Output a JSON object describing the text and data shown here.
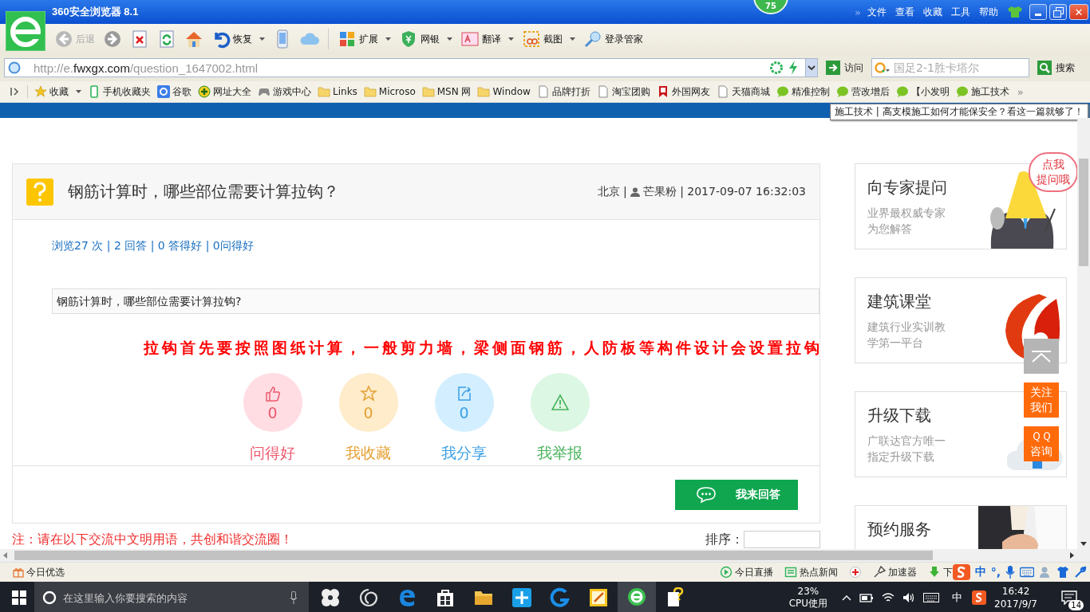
{
  "window": {
    "title": "360安全浏览器 8.1",
    "badge": "75",
    "menu_more": "»",
    "menu": [
      "文件",
      "查看",
      "收藏",
      "工具",
      "帮助"
    ],
    "close": "✕"
  },
  "toolbar": [
    {
      "kind": "back",
      "label": "后退",
      "disabled": true
    },
    {
      "kind": "forward"
    },
    {
      "kind": "stop"
    },
    {
      "kind": "refresh"
    },
    {
      "kind": "home"
    },
    {
      "kind": "undo",
      "label": "恢复",
      "caret": true
    },
    {
      "kind": "phone"
    },
    {
      "kind": "cloud"
    },
    {
      "kind": "extensions",
      "label": "扩展",
      "caret": true
    },
    {
      "kind": "bank",
      "label": "网银",
      "caret": true
    },
    {
      "kind": "translate",
      "label": "翻译",
      "caret": true
    },
    {
      "kind": "screenshot",
      "label": "截图",
      "caret": true
    },
    {
      "kind": "login",
      "label": "登录管家"
    }
  ],
  "address_bar": {
    "prefix": "http://e.",
    "domain": "fwxgx.com",
    "path": "/question_1647002.html",
    "go": "访问"
  },
  "search": {
    "placeholder": "国足2-1胜卡塔尔",
    "button": "搜索"
  },
  "bookmarks": [
    {
      "kind": "star",
      "label": "收藏",
      "caret": true
    },
    {
      "kind": "phone",
      "label": "手机收藏夹"
    },
    {
      "kind": "google",
      "label": "谷歌"
    },
    {
      "kind": "plus",
      "label": "网址大全"
    },
    {
      "kind": "gamepad",
      "label": "游戏中心"
    },
    {
      "kind": "folder",
      "label": "Links"
    },
    {
      "kind": "folder",
      "label": "Microso"
    },
    {
      "kind": "folder",
      "label": "MSN 网"
    },
    {
      "kind": "folder",
      "label": "Window"
    },
    {
      "kind": "page",
      "label": "品牌打折"
    },
    {
      "kind": "page",
      "label": "淘宝团购"
    },
    {
      "kind": "flag",
      "label": "外国网友"
    },
    {
      "kind": "page",
      "label": "天猫商城"
    },
    {
      "kind": "chat",
      "label": "精准控制"
    },
    {
      "kind": "chat",
      "label": "营改增后"
    },
    {
      "kind": "chat",
      "label": "【小发明"
    },
    {
      "kind": "chat",
      "label": "施工技术"
    }
  ],
  "bookmarks_more": "»",
  "tooltip": "施工技术 | 高支模施工如何才能保安全？看这一篇就够了！",
  "question": {
    "title": "钢筋计算时，哪些部位需要计算拉钩？",
    "location": "北京 |",
    "byline": "芒果粉 | 2017-09-07 16:32:03",
    "stats": "浏览27 次 | 2 回答 | 0 答得好 | 0问得好",
    "body": "钢筋计算时，哪些部位需要计算拉钩?",
    "answer": "拉钩首先要按照图纸计算，一般剪力墙，梁侧面钢筋，人防板等构件设计会设置拉钩"
  },
  "actions": [
    {
      "kind": "like",
      "count": "0",
      "label": "问得好",
      "color": "#ee5a6e"
    },
    {
      "kind": "favorite",
      "count": "0",
      "label": "我收藏",
      "color": "#e5a032"
    },
    {
      "kind": "share",
      "count": "0",
      "label": "我分享",
      "color": "#3a9fe6"
    },
    {
      "kind": "report",
      "label": "我举报",
      "color": "#48b25a"
    }
  ],
  "answer_button": "我来回答",
  "notice": "注：请在以下交流中文明用语，共创和谐交流圈！",
  "sort_label": "排序：",
  "sidebar": [
    {
      "kind": "mascot",
      "title": "向专家提问",
      "subtitle": "业界最权威专家为您解答",
      "callout": [
        "点我",
        "提问哦"
      ]
    },
    {
      "kind": "logo",
      "title": "建筑课堂",
      "subtitle": "建筑行业实训教学第一平台"
    },
    {
      "kind": "cloud",
      "title": "升级下载",
      "subtitle": "广联达官方唯一指定升级下载"
    },
    {
      "title": "预约服务"
    }
  ],
  "float_buttons": [
    {
      "kind": "top"
    },
    {
      "kind": "text",
      "label": "关注我们"
    },
    {
      "kind": "text",
      "label": "ＱＱ咨询"
    }
  ],
  "status_bar": {
    "left": "今日优选",
    "items": [
      {
        "kind": "play",
        "label": "今日直播"
      },
      {
        "kind": "news",
        "label": "热点新闻"
      },
      {
        "kind": "cross"
      },
      {
        "kind": "rocket",
        "label": "加速器"
      },
      {
        "kind": "download",
        "label": "下"
      }
    ],
    "ime": [
      "中",
      "°,"
    ]
  },
  "taskbar": {
    "search_placeholder": "在这里输入你要搜索的内容",
    "apps": [
      {
        "kind": "fan",
        "selected": false
      },
      {
        "kind": "swirl",
        "selected": false
      },
      {
        "kind": "edge",
        "selected": false
      },
      {
        "kind": "store",
        "selected": false
      },
      {
        "kind": "folder",
        "selected": false
      },
      {
        "kind": "plus",
        "selected": false
      },
      {
        "kind": "g",
        "selected": false
      },
      {
        "kind": "notes",
        "selected": false
      },
      {
        "kind": "browser",
        "selected": true
      },
      {
        "kind": "help",
        "selected": false
      }
    ],
    "cpu": "23%",
    "cpu_label": "CPU使用",
    "ime": "中",
    "time": "16:42",
    "date": "2017/9/7",
    "notifications": "14"
  }
}
